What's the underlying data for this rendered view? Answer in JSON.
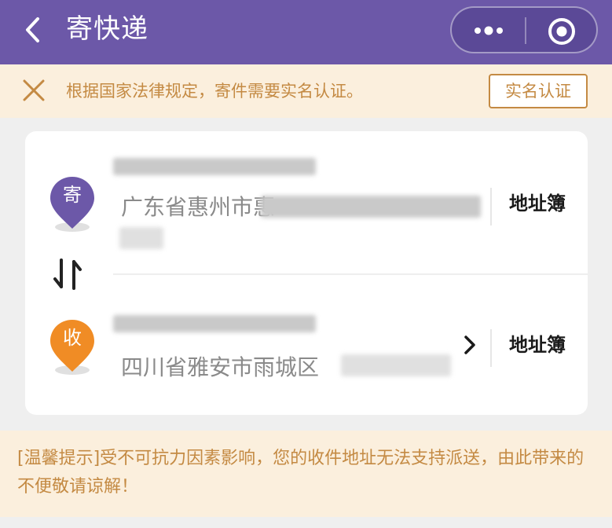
{
  "header": {
    "title": "寄快递",
    "back_icon": "chevron-left-icon",
    "more_icon": "more-dots-icon",
    "close_icon": "record-circle-icon",
    "bg_color": "#6c58a8"
  },
  "notice": {
    "text": "根据国家法律规定，寄件需要实名认证。",
    "button_label": "实名认证",
    "close_icon": "close-icon",
    "text_color": "#c48a43"
  },
  "sender": {
    "badge": "寄",
    "badge_color": "#6c58a8",
    "address": "广东省惠州市惠",
    "address_book_label": "地址簿"
  },
  "receiver": {
    "badge": "收",
    "badge_color": "#f08c25",
    "address": "四川省雅安市雨城区",
    "address_book_label": "地址簿"
  },
  "swap_icon": "swap-arrows-icon",
  "tip": {
    "text": "[温馨提示]受不可抗力因素影响，您的收件地址无法支持派送，由此带来的不便敬请谅解！"
  }
}
